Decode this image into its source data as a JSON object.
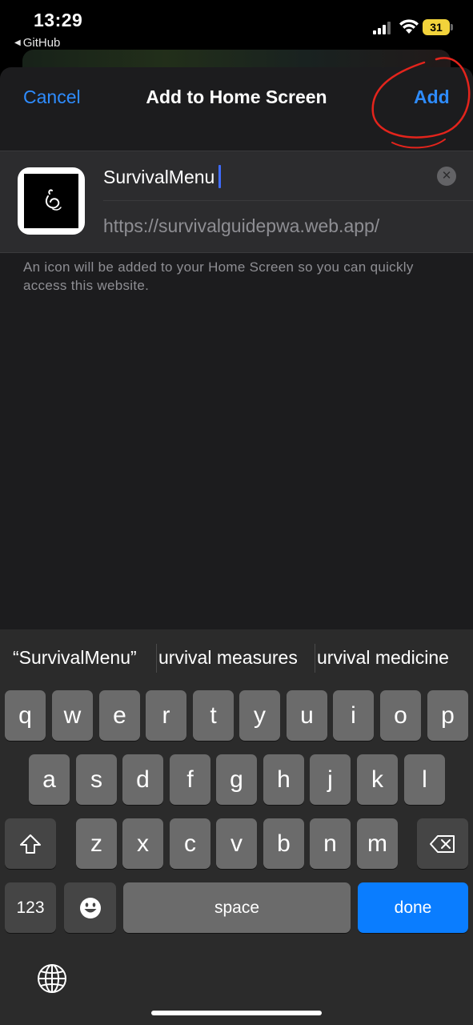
{
  "status_bar": {
    "time": "13:29",
    "back_app": "GitHub",
    "battery": "31"
  },
  "nav": {
    "cancel_label": "Cancel",
    "title": "Add to Home Screen",
    "add_label": "Add"
  },
  "form": {
    "name_value": "SurvivalMenu",
    "url": "https://survivalguidepwa.web.app/",
    "hint": "An icon will be added to your Home Screen so you can quickly access this website."
  },
  "suggestions": [
    "“SurvivalMenu”",
    "urvival measures",
    "urvival medicine"
  ],
  "keyboard": {
    "row1": [
      "q",
      "w",
      "e",
      "r",
      "t",
      "y",
      "u",
      "i",
      "o",
      "p"
    ],
    "row2": [
      "a",
      "s",
      "d",
      "f",
      "g",
      "h",
      "j",
      "k",
      "l"
    ],
    "row3": [
      "z",
      "x",
      "c",
      "v",
      "b",
      "n",
      "m"
    ],
    "numbers_label": "123",
    "space_label": "space",
    "done_label": "done"
  },
  "colors": {
    "accent": "#2e8cff",
    "done_key": "#0a7dff",
    "annotation": "#e3241c"
  }
}
